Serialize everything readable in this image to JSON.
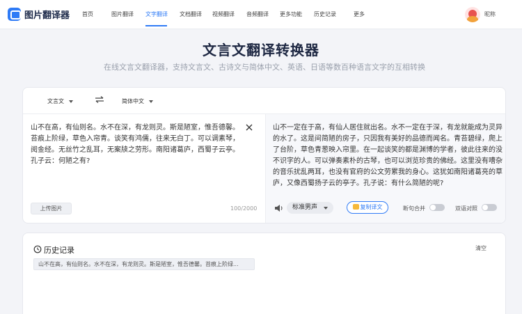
{
  "app": {
    "name": "图片翻译器"
  },
  "nav": {
    "items": [
      {
        "label": "首页"
      },
      {
        "label": "图片翻译"
      },
      {
        "label": "文字翻译"
      },
      {
        "label": "文档翻译"
      },
      {
        "label": "视频翻译"
      },
      {
        "label": "音频翻译"
      },
      {
        "label": "更多功能"
      },
      {
        "label": "历史记录"
      },
      {
        "label": "更多"
      }
    ],
    "active_index": 2
  },
  "user": {
    "nickname": "昵称"
  },
  "hero": {
    "title": "文言文翻译转换器",
    "subtitle": "在线文言文翻译器，支持文言文、古诗文与简体中文、英语、日语等数百种语言文字的互相转换"
  },
  "translator": {
    "source_lang": "文言文",
    "target_lang": "简体中文",
    "source_text": "山不在高，有仙则名。水不在深，有龙则灵。斯是陋室，惟吾德馨。苔痕上阶绿，草色入帘青。谈笑有鸿儒，往来无白丁。可以调素琴，阅金经。无丝竹之乱耳，无案牍之劳形。南阳诸葛庐，西蜀子云亭。孔子云：何陋之有?",
    "target_text": "山不一定在于高，有仙人居住就出名。水不一定在于深，有龙就能成为灵异的水了。这是间简陋的房子，只因我有美好的品德而闻名。青苔碧绿，爬上了台阶，草色青葱映入帘里。在一起谈笑的都是渊博的学者，彼此往来的没不识字的人。可以弹奏素朴的古琴，也可以浏览珍贵的佛经。这里没有嘈杂的音乐扰乱两耳，也没有官府的公文劳累我的身心。这犹如南阳诸葛亮的草庐，又像西蜀扬子云的亭子。孔子说：有什么简陋的呢?",
    "upload_label": "上传图片",
    "char_count": "100/2000",
    "voice": "标准男声",
    "copy_label": "复制译文",
    "toggle_merge_label": "断句合并",
    "toggle_compare_label": "双语对照"
  },
  "history": {
    "title": "历史记录",
    "clear_label": "清空",
    "items": [
      {
        "text": "山不在高，有仙则名。水不在深，有龙则灵。斯是陋室，惟吾德馨。苔痕上阶绿..."
      }
    ]
  },
  "colors": {
    "accent": "#2f7bf6",
    "title": "#1d2742"
  }
}
